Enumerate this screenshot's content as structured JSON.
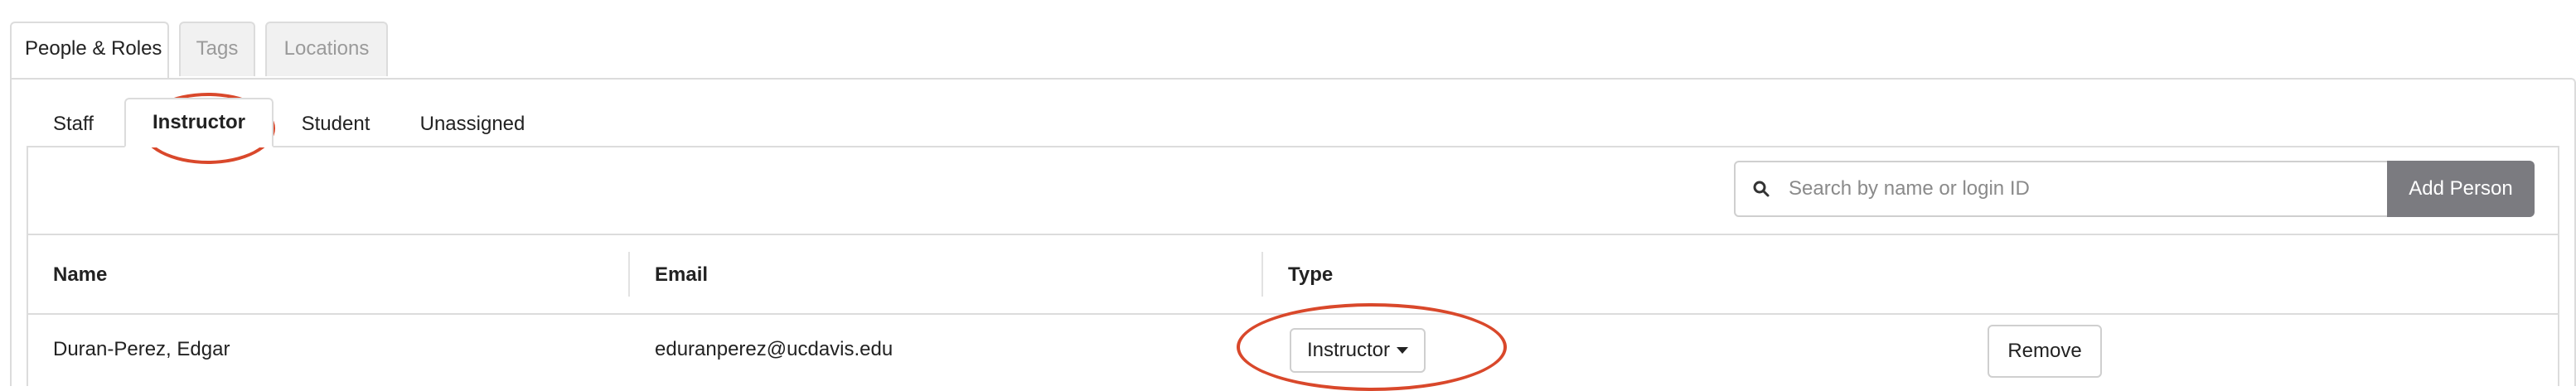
{
  "outer_tabs": [
    {
      "label": "People & Roles",
      "state": "active"
    },
    {
      "label": "Tags",
      "state": "disabled"
    },
    {
      "label": "Locations",
      "state": "disabled"
    }
  ],
  "inner_tabs": [
    {
      "label": "Staff"
    },
    {
      "label": "Instructor",
      "active": true
    },
    {
      "label": "Student"
    },
    {
      "label": "Unassigned"
    }
  ],
  "search": {
    "placeholder": "Search by name or login ID",
    "value": ""
  },
  "toolbar": {
    "add_person_label": "Add Person"
  },
  "table": {
    "columns": [
      "Name",
      "Email",
      "Type"
    ],
    "rows": [
      {
        "name": "Duran-Perez, Edgar",
        "email": "eduranperez@ucdavis.edu",
        "type": "Instructor",
        "action": "Remove"
      }
    ]
  },
  "colors": {
    "accent_gray": "#7b7b80",
    "annotation": "#d9482b",
    "border": "#dcdcdc"
  }
}
